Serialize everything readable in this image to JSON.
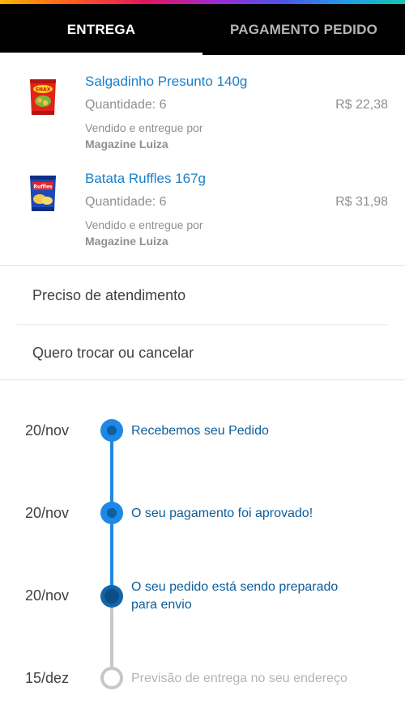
{
  "tabs": {
    "entrega": "ENTREGA",
    "pagamento": "PAGAMENTO PEDIDO",
    "active": "ENTREGA"
  },
  "products": [
    {
      "name": "Salgadinho Presunto 140g",
      "quantity": "Quantidade: 6",
      "price": "R$ 22,38",
      "sold_by_label": "Vendido e entregue por",
      "seller": "Magazine Luiza",
      "thumb_icon": "snack-bag-red-icon"
    },
    {
      "name": "Batata Ruffles 167g",
      "quantity": "Quantidade: 6",
      "price": "R$ 31,98",
      "sold_by_label": "Vendido e entregue por",
      "seller": "Magazine Luiza",
      "thumb_icon": "snack-bag-blue-icon"
    }
  ],
  "actions": {
    "support": "Preciso de atendimento",
    "exchange": "Quero trocar ou cancelar"
  },
  "timeline": [
    {
      "date": "20/nov",
      "text": "Recebemos seu Pedido",
      "status": "done"
    },
    {
      "date": "20/nov",
      "text": "O seu pagamento foi aprovado!",
      "status": "done"
    },
    {
      "date": "20/nov",
      "text_line1": "O seu pedido está sendo preparado",
      "text_line2": "para envio",
      "status": "current"
    },
    {
      "date": "15/dez",
      "text": "Previsão de entrega no seu endereço",
      "status": "pending"
    }
  ],
  "colors": {
    "accent_blue": "#1e88e5",
    "product_link": "#1a7fc9",
    "timeline_text": "#0d5d9a",
    "tabbar_bg": "#000000"
  }
}
